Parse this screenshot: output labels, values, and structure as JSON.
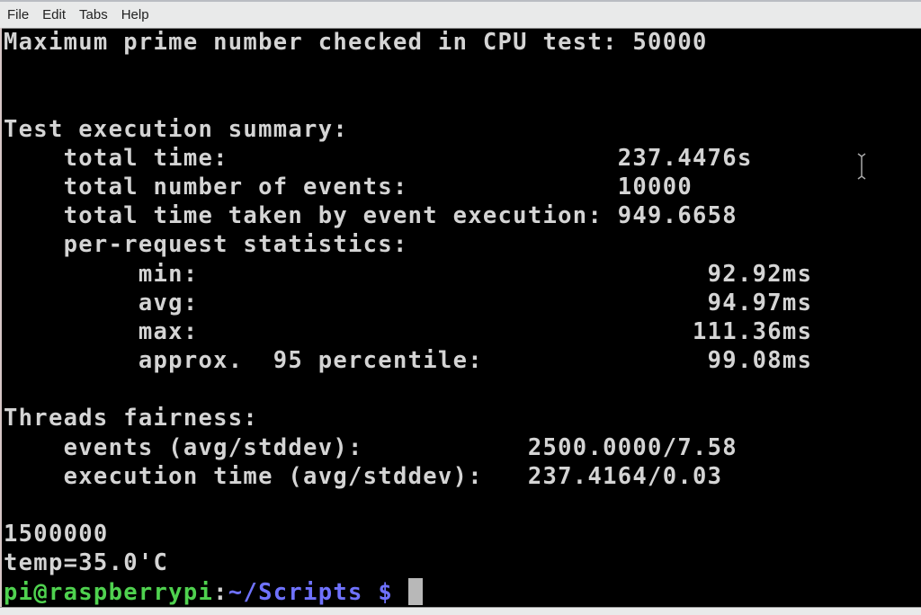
{
  "menu": [
    "File",
    "Edit",
    "Tabs",
    "Help"
  ],
  "terminal": {
    "lines": [
      "Maximum prime number checked in CPU test: 50000",
      "",
      "",
      "Test execution summary:",
      "    total time:                          237.4476s",
      "    total number of events:              10000",
      "    total time taken by event execution: 949.6658",
      "    per-request statistics:",
      "         min:                                  92.92ms",
      "         avg:                                  94.97ms",
      "         max:                                 111.36ms",
      "         approx.  95 percentile:               99.08ms",
      "",
      "Threads fairness:",
      "    events (avg/stddev):           2500.0000/7.58",
      "    execution time (avg/stddev):   237.4164/0.03",
      "",
      "1500000",
      "temp=35.0'C"
    ],
    "prompt": {
      "user_host": "pi@raspberrypi",
      "separator": ":",
      "path": "~/Scripts $",
      "input": " "
    }
  },
  "colors": {
    "prompt_user": "#4fd24f",
    "prompt_path": "#6f72ff",
    "text": "#d4d4d4",
    "background": "#000000"
  }
}
